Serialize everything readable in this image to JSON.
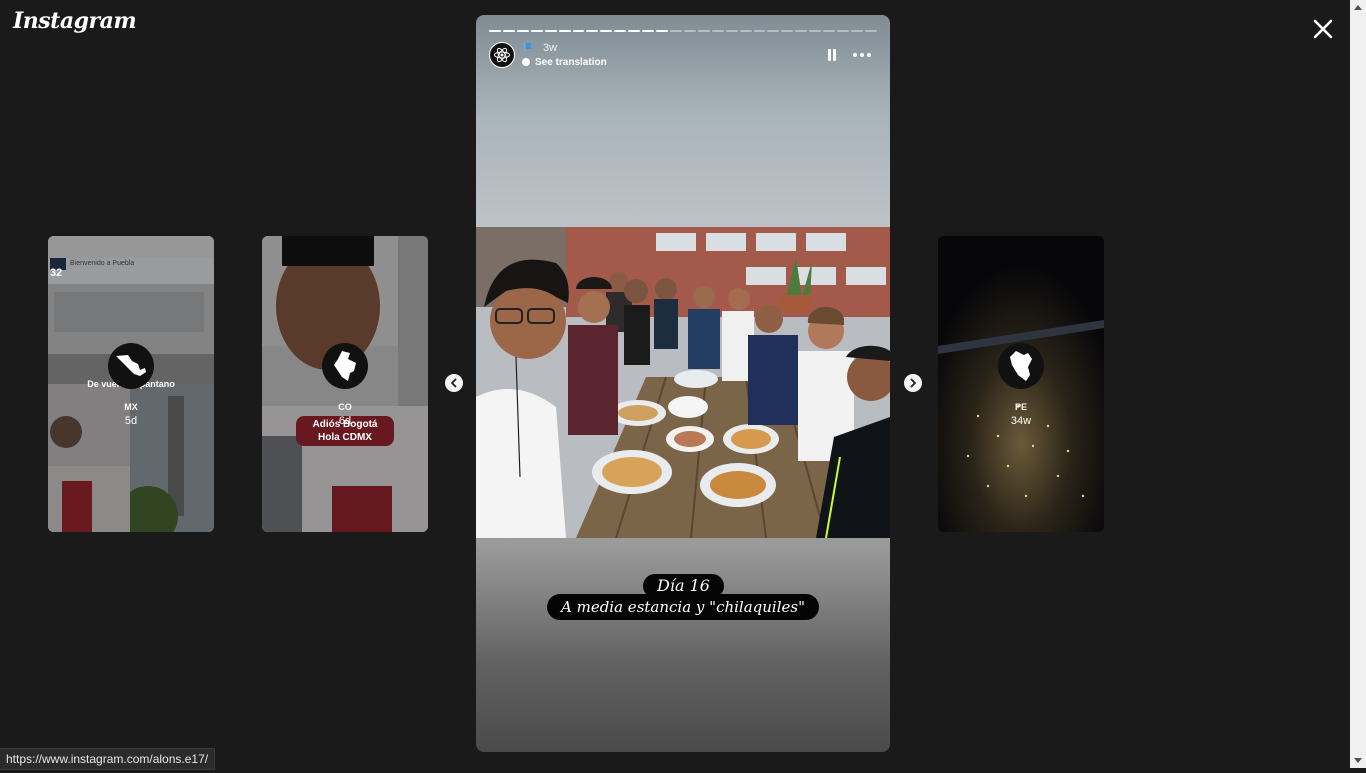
{
  "app": {
    "logo_text": "Instagram"
  },
  "story": {
    "time_ago": "3w",
    "see_translation": "See translation",
    "progress_total_segments": 28,
    "progress_done_segments": 13,
    "caption_line1": "Día 16",
    "caption_line2": "A media estancia y \"chilaquiles\""
  },
  "previews": [
    {
      "code": "MX",
      "age": "5d",
      "overlay_text": "De vuelta al pantano",
      "header_text": "Bienvenido a Puebla",
      "sign_number": "32"
    },
    {
      "code": "CO",
      "age": "6d",
      "sticker_line1": "Adiós Bogotá",
      "sticker_line2": "Hola CDMX"
    },
    {
      "code": "PE",
      "age": "34w"
    }
  ],
  "status_bar": {
    "url": "https://www.instagram.com/alons.e17/"
  },
  "colors": {
    "background": "#1a1a1a",
    "sticker": "#6a1820",
    "caption_bg": "#050505"
  },
  "icons": [
    "close-icon",
    "pause-icon",
    "more-icon",
    "chevron-left-icon",
    "chevron-right-icon",
    "atom-icon",
    "mexico-map-icon",
    "colombia-map-icon",
    "peru-map-icon",
    "flag-icon"
  ]
}
